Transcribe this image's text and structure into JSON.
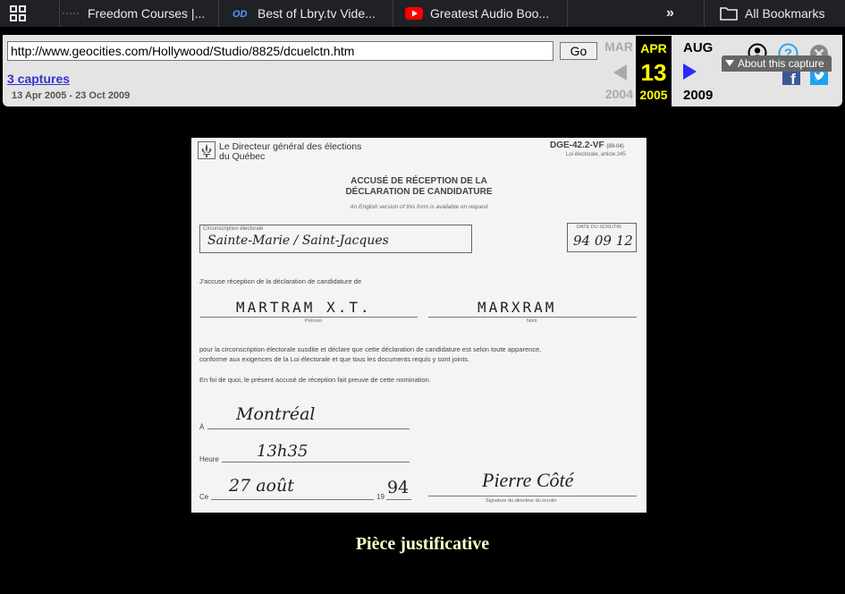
{
  "bookmarks_bar": {
    "items": [
      {
        "label": "Freedom Courses |...",
        "icon": "dotted-line-icon"
      },
      {
        "label": "Best of Lbry.tv Vide...",
        "icon": "lbry-logo-icon"
      },
      {
        "label": "Greatest Audio Boo...",
        "icon": "youtube-icon",
        "icon_color": "#ff0000"
      }
    ],
    "more_label": "»",
    "all_bookmarks_label": "All Bookmarks"
  },
  "wayback": {
    "url_value": "http://www.geocities.com/Hollywood/Studio/8825/dcuelctn.htm",
    "go_label": "Go",
    "captures_label": "3 captures",
    "date_range": "13 Apr 2005 - 23 Oct 2009",
    "prev": {
      "month": "MAR",
      "year": "2004"
    },
    "current": {
      "month": "APR",
      "day": "13",
      "year": "2005"
    },
    "next": {
      "month": "AUG",
      "year": "2009"
    },
    "about_label": "About this capture",
    "colors": {
      "current_bg": "#000000",
      "current_fg": "#ffff00",
      "next_arrow": "#2a2aff",
      "help": "#2ea3f2",
      "facebook": "#3b5998",
      "twitter": "#1da1f2"
    }
  },
  "document": {
    "issuer_line1": "Le Directeur général des élections",
    "issuer_line2": "du Québec",
    "form_code": "DGE-42.2-VF",
    "form_rev": "(89-04)",
    "form_law": "Loi électorale, article 245",
    "title_line1": "ACCUSÉ DE RÉCEPTION DE LA",
    "title_line2": "DÉCLARATION DE CANDIDATURE",
    "english_note": "An English version of this form is available on request",
    "circ_label": "Circonscription électorale",
    "circ_value": "Sainte-Marie / Saint-Jacques",
    "date_scrutin_label": "DATE DU SCRUTIN",
    "date_scrutin_value": "94 09 12",
    "ack_text": "J'accuse réception de la déclaration de candidature de",
    "firstname_value": "MARTRAM   X.T.",
    "firstname_label": "Prénom",
    "lastname_value": "MARXRAM",
    "lastname_label": "Nom",
    "para_line1": "pour la circonscription électorale susdite et déclare que cette déclaration de candidature est selon toute apparence,",
    "para_line2": "conforme aux exigences de la Loi électorale et que tous les documents requis y sont joints.",
    "faith_text": "En foi de quoi, le présent accusé de réception fait preuve de cette nomination.",
    "a_label": "À",
    "a_value": "Montréal",
    "heure_label": "Heure",
    "heure_value": "13h35",
    "ce_label": "Ce",
    "ce_value": "27 août",
    "year_prefix": "19",
    "year_value": "94",
    "signature_value": "Pierre Côté",
    "signature_label": "Signature du directeur du scrutin"
  },
  "caption": "Pièce justificative"
}
